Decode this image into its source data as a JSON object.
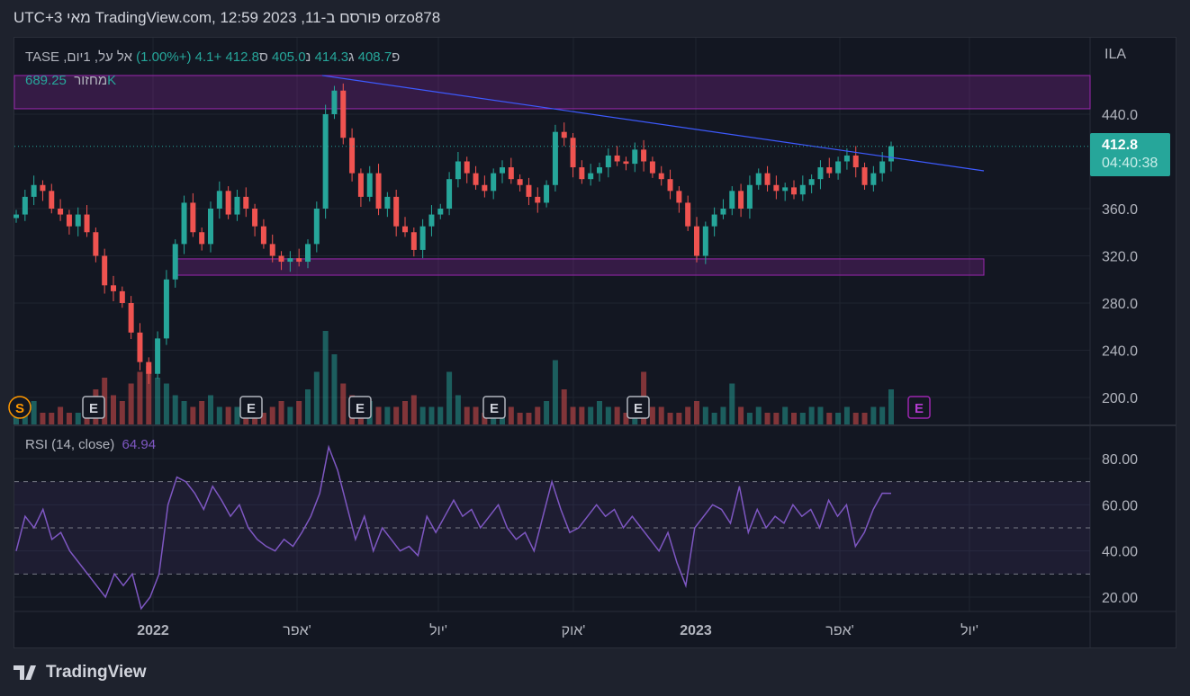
{
  "header": {
    "title": "orzo878 פורסם ב-TradingView.com, 12:59 2023 ,11 מאי UTC+3"
  },
  "legend": {
    "symbol": "אל על, 1יום, TASE",
    "open_label": "פ",
    "open": "408.7",
    "high_label": "ג",
    "high": "414.3",
    "low_label": "נ",
    "low": "405.0",
    "close_label": "ס",
    "close": "412.8",
    "change": "+4.1 (+1.00%)",
    "volume_label": "מחזור",
    "volume": "689.25K"
  },
  "price_tag": {
    "price": "412.8",
    "countdown": "04:40:38"
  },
  "currency": "ILA",
  "rsi": {
    "label": "RSI (14, close)",
    "value": "64.94"
  },
  "brand": "TradingView",
  "colors": {
    "up": "#26a69a",
    "down": "#ef5350",
    "zone": "#9c27b0",
    "trend": "#3d5afe",
    "rsi": "#7e57c2"
  },
  "chart_data": [
    {
      "type": "candlestick",
      "title": "אל על, 1יום, TASE",
      "ylim": [
        177,
        505
      ],
      "yticks": [
        "440.0",
        "360.0",
        "320.0",
        "280.0",
        "240.0",
        "200.0"
      ],
      "ytick_values": [
        440,
        360,
        320,
        280,
        240,
        200
      ],
      "xticks": [
        "2022",
        "אפר'",
        "יול'",
        "אוק'",
        "2023",
        "אפר'",
        "יול'"
      ],
      "closes": [
        355,
        370,
        380,
        375,
        360,
        355,
        345,
        355,
        340,
        320,
        295,
        290,
        280,
        255,
        230,
        220,
        250,
        300,
        330,
        365,
        340,
        330,
        360,
        375,
        355,
        370,
        360,
        345,
        330,
        320,
        315,
        318,
        315,
        330,
        360,
        440,
        460,
        420,
        390,
        370,
        390,
        360,
        370,
        345,
        340,
        325,
        345,
        355,
        360,
        385,
        400,
        390,
        380,
        375,
        390,
        395,
        385,
        380,
        370,
        365,
        380,
        425,
        420,
        395,
        385,
        390,
        395,
        405,
        400,
        398,
        410,
        400,
        390,
        385,
        375,
        365,
        345,
        320,
        345,
        355,
        360,
        375,
        360,
        380,
        390,
        380,
        375,
        378,
        372,
        380,
        385,
        395,
        390,
        400,
        405,
        395,
        380,
        390,
        400,
        412.8
      ],
      "volumes": [
        3,
        2,
        4,
        2,
        2,
        3,
        2,
        2,
        3,
        6,
        8,
        5,
        4,
        7,
        9,
        10,
        8,
        7,
        5,
        4,
        3,
        4,
        5,
        3,
        3,
        3,
        2,
        3,
        2,
        3,
        4,
        3,
        4,
        6,
        9,
        16,
        12,
        7,
        5,
        4,
        4,
        3,
        3,
        3,
        4,
        5,
        3,
        3,
        3,
        9,
        5,
        3,
        3,
        2,
        3,
        4,
        3,
        2,
        2,
        3,
        4,
        11,
        6,
        3,
        3,
        3,
        4,
        3,
        3,
        2,
        4,
        9,
        3,
        3,
        2,
        2,
        3,
        4,
        3,
        2,
        3,
        7,
        3,
        2,
        3,
        2,
        2,
        3,
        2,
        2,
        3,
        3,
        2,
        2,
        3,
        2,
        2,
        3,
        3,
        6
      ],
      "earnings_markers": [
        "E",
        "E",
        "E",
        "E",
        "E",
        "E"
      ],
      "split_marker": "S",
      "zones": [
        {
          "from": 444.6,
          "to": 472.8
        },
        {
          "from": 303.6,
          "to": 317.4
        }
      ],
      "trendline": {
        "from": 472.8,
        "to": 392
      }
    },
    {
      "type": "line",
      "title": "RSI (14, close)",
      "ylim": [
        15,
        90
      ],
      "yticks": [
        "80.00",
        "60.00",
        "40.00",
        "20.00"
      ],
      "ytick_values": [
        80,
        60,
        40,
        20
      ],
      "bands": [
        70,
        50,
        30
      ],
      "values": [
        40,
        55,
        50,
        58,
        45,
        48,
        40,
        35,
        30,
        25,
        20,
        30,
        25,
        30,
        15,
        20,
        30,
        60,
        72,
        70,
        65,
        58,
        68,
        62,
        55,
        60,
        50,
        45,
        42,
        40,
        45,
        42,
        48,
        55,
        65,
        85,
        75,
        60,
        45,
        55,
        40,
        50,
        45,
        40,
        42,
        38,
        55,
        48,
        55,
        62,
        55,
        58,
        50,
        55,
        60,
        50,
        45,
        48,
        40,
        55,
        70,
        58,
        48,
        50,
        55,
        60,
        55,
        58,
        50,
        55,
        50,
        45,
        40,
        48,
        35,
        25,
        50,
        55,
        60,
        58,
        52,
        68,
        48,
        58,
        50,
        55,
        52,
        60,
        55,
        58,
        50,
        62,
        55,
        60,
        42,
        48,
        58,
        65,
        64.94
      ]
    }
  ]
}
